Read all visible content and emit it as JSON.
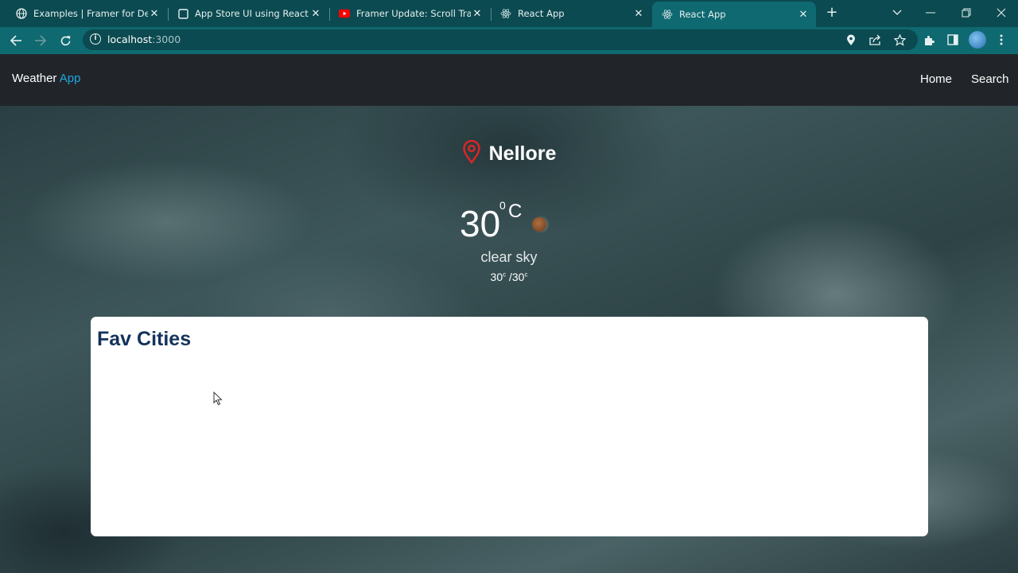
{
  "browser": {
    "tabs": [
      {
        "title": "Examples | Framer for Develop",
        "icon": "globe-icon"
      },
      {
        "title": "App Store UI using React and F",
        "icon": "square-icon"
      },
      {
        "title": "Framer Update: Scroll Transfor",
        "icon": "youtube-icon"
      },
      {
        "title": "React App",
        "icon": "react-icon"
      },
      {
        "title": "React App",
        "icon": "react-icon",
        "active": true
      }
    ],
    "url_host": "localhost",
    "url_port": ":3000"
  },
  "navbar": {
    "brand_main": "Weather ",
    "brand_accent": "App",
    "links": {
      "home": "Home",
      "search": "Search"
    }
  },
  "weather": {
    "city": "Nellore",
    "temperature": "30",
    "degree_symbol": "0",
    "unit": "C",
    "icon": "moon-icon",
    "description": "clear sky",
    "max_temp": "30",
    "min_temp": "30",
    "small_unit": "c",
    "separator": " /"
  },
  "favorites": {
    "title": "Fav Cities",
    "items": []
  },
  "colors": {
    "tabbar": "#0b4a50",
    "toolbar": "#0f6970",
    "navbar": "#212529",
    "brand_accent": "#1fa8e0",
    "location_pin": "#e02424",
    "fav_title": "#13325c"
  }
}
